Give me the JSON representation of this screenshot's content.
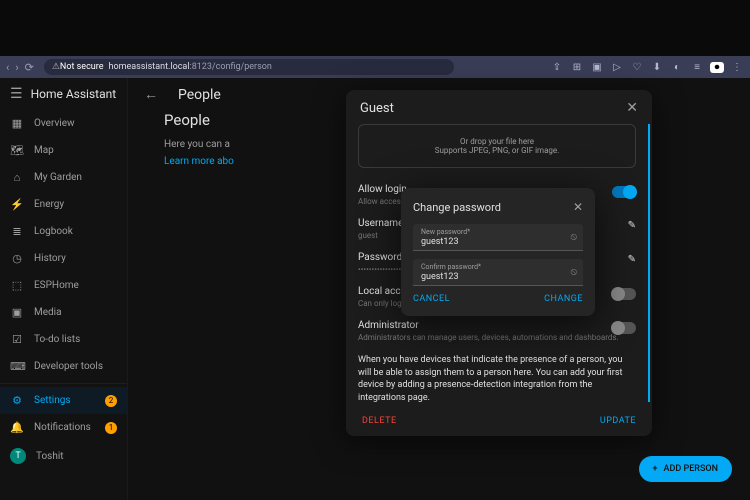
{
  "browser": {
    "secure_label": "Not secure",
    "host": "homeassistant.local",
    "port_path": ":8123/config/person"
  },
  "app_title": "Home Assistant",
  "sidebar": [
    {
      "icon": "▦",
      "label": "Overview"
    },
    {
      "icon": "🗺",
      "label": "Map"
    },
    {
      "icon": "⌂",
      "label": "My Garden"
    },
    {
      "icon": "⚡",
      "label": "Energy"
    },
    {
      "icon": "≣",
      "label": "Logbook"
    },
    {
      "icon": "◷",
      "label": "History"
    },
    {
      "icon": "⬚",
      "label": "ESPHome"
    },
    {
      "icon": "▣",
      "label": "Media"
    },
    {
      "icon": "☑",
      "label": "To-do lists"
    },
    {
      "icon": "⌨",
      "label": "Developer tools"
    },
    {
      "icon": "⚙",
      "label": "Settings",
      "active": true,
      "badge": "2"
    },
    {
      "icon": "🔔",
      "label": "Notifications",
      "badge": "1"
    },
    {
      "icon": "T",
      "label": "Toshit",
      "avatar": true
    }
  ],
  "page": {
    "title": "People",
    "heading": "People",
    "hint": "Here you can a",
    "link": "Learn more abo"
  },
  "drawer": {
    "title": "Guest",
    "upload_line1": "Or drop your file here",
    "upload_line2": "Supports JPEG, PNG, or GIF image.",
    "allow_login_lbl": "Allow login",
    "allow_login_sub": "Allow access",
    "username_lbl": "Username",
    "username_val": "guest",
    "password_lbl": "Password",
    "password_val": "••••••••••••••••",
    "local_lbl": "Local access",
    "local_sub": "Can only log",
    "admin_lbl": "Administrator",
    "admin_sub": "Administrators can manage users, devices, automations and dashboards.",
    "info": "When you have devices that indicate the presence of a person, you will be able to assign them to a person here. You can add your first device by adding a presence-detection integration from the integrations page.",
    "delete": "DELETE",
    "update": "UPDATE"
  },
  "dialog": {
    "title": "Change password",
    "new_lbl": "New password*",
    "new_val": "guest123",
    "confirm_lbl": "Confirm password*",
    "confirm_val": "guest123",
    "cancel": "CANCEL",
    "change": "CHANGE"
  },
  "fab": "ADD PERSON"
}
